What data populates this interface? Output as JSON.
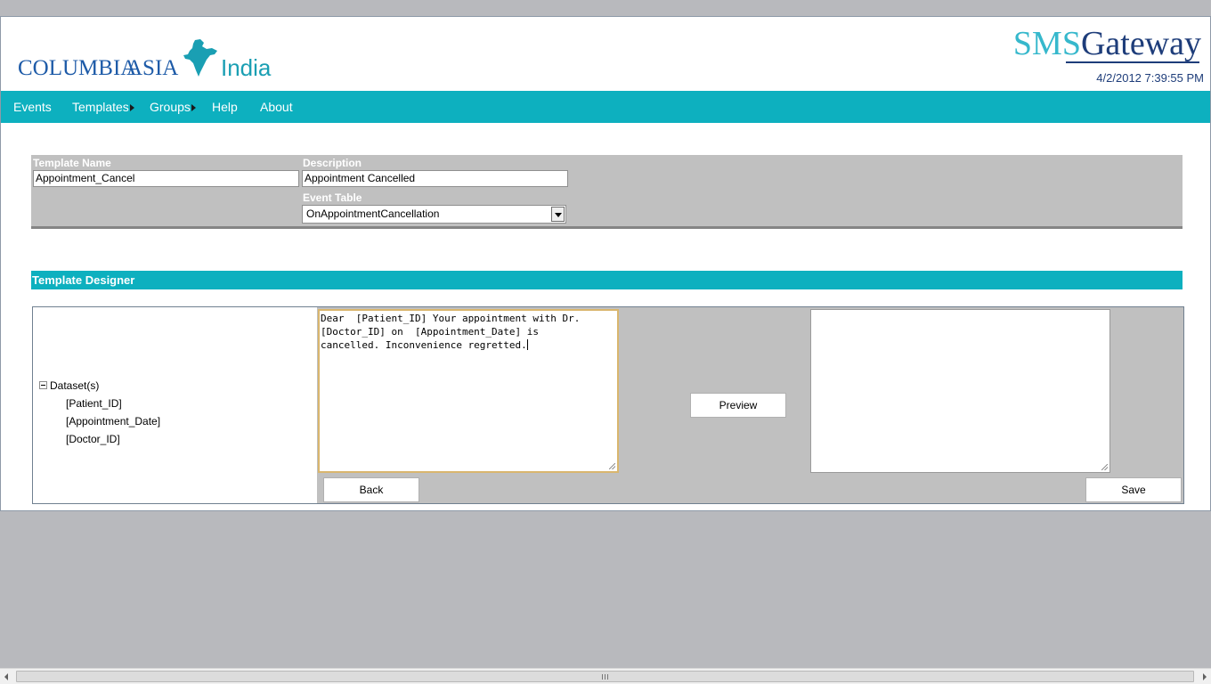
{
  "header": {
    "logo": {
      "brand_first": "COLUMBIA",
      "brand_second": "ASIA",
      "region": "India"
    },
    "product_logo": {
      "sms": "SMS",
      "gateway": "Gateway"
    },
    "datetime": "4/2/2012 7:39:55 PM"
  },
  "nav": {
    "items": [
      {
        "label": "Events",
        "submenu": false
      },
      {
        "label": "Templates",
        "submenu": true
      },
      {
        "label": "Groups",
        "submenu": true
      },
      {
        "label": "Help",
        "submenu": false
      },
      {
        "label": "About",
        "submenu": false
      }
    ]
  },
  "form": {
    "template_name_label": "Template Name",
    "template_name_value": "Appointment_Cancel",
    "description_label": "Description",
    "description_value": "Appointment Cancelled",
    "event_table_label": "Event Table",
    "event_table_value": "OnAppointmentCancellation"
  },
  "designer": {
    "title": "Template Designer",
    "tree": {
      "root": "Dataset(s)",
      "items": [
        "[Patient_ID]",
        "[Appointment_Date]",
        "[Doctor_ID]"
      ]
    },
    "template_text": "Dear  [Patient_ID] Your appointment with Dr.\n[Doctor_ID] on  [Appointment_Date] is\ncancelled. Inconvenience regretted.",
    "preview_label": "Preview",
    "back_label": "Back",
    "save_label": "Save"
  },
  "colors": {
    "accent": "#0db0bf",
    "panel_gray": "#c0c0c0",
    "background": "#b8b9bd",
    "logo_blue": "#1e5ba8",
    "date_navy": "#1e3d7a"
  }
}
